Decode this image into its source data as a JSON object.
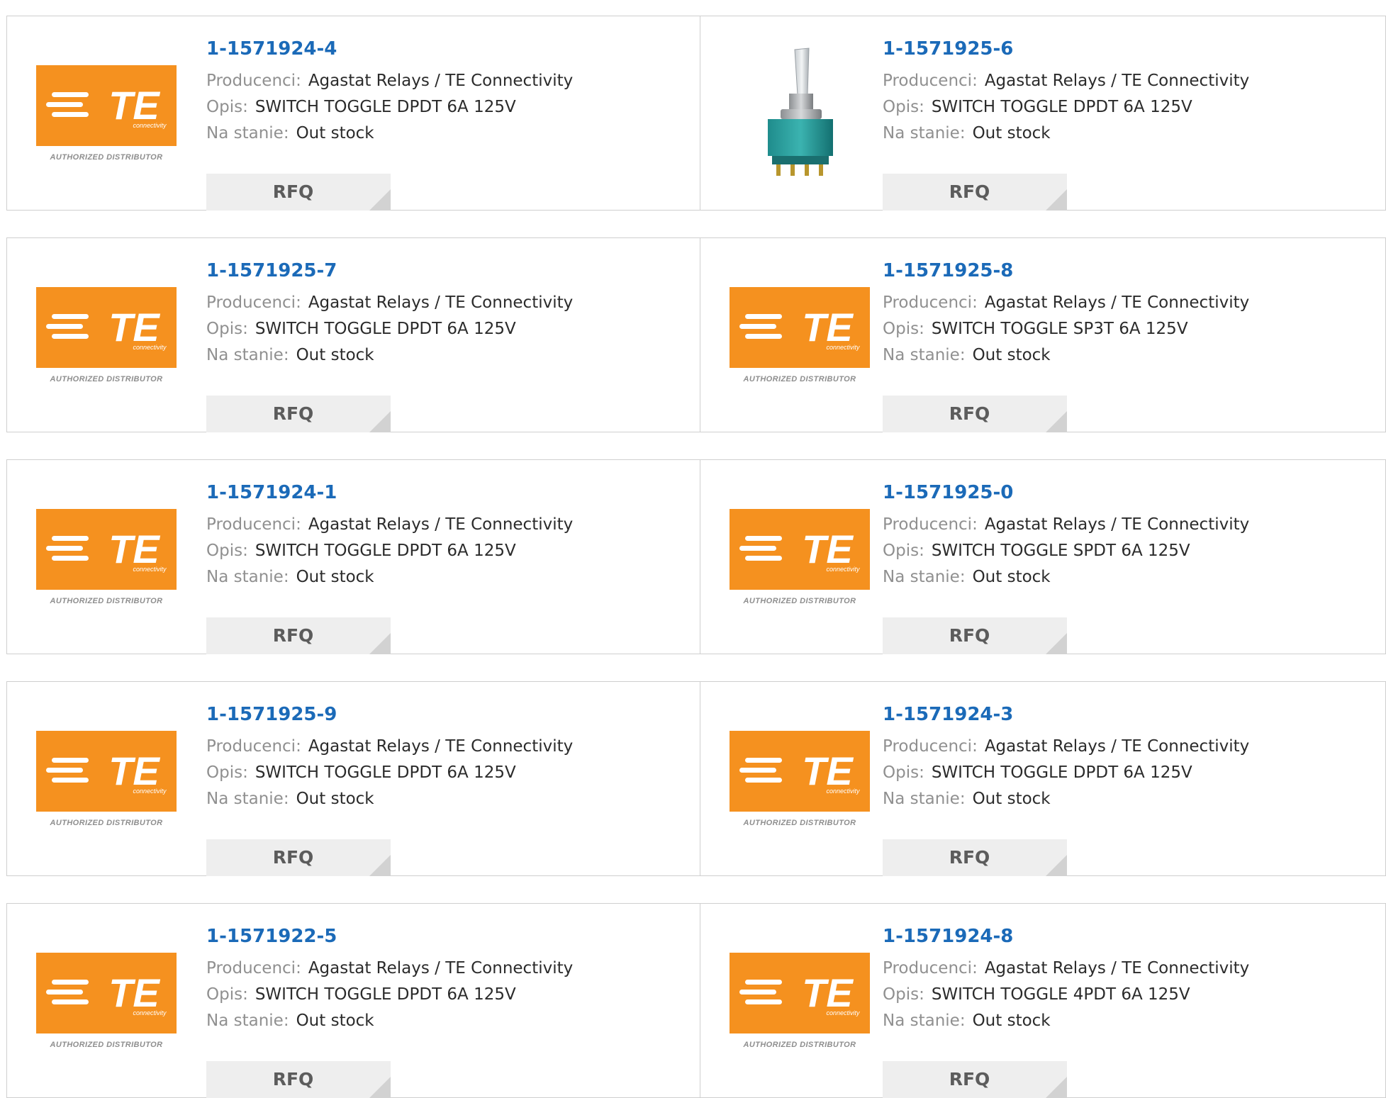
{
  "colors": {
    "part_number": "#1b6ab8",
    "te_orange": "#f5911f",
    "rfq_bg": "#eeeeee"
  },
  "labels": {
    "manufacturer": "Producenci:",
    "description": "Opis:",
    "stock": "Na stanie:",
    "rfq": "RFQ"
  },
  "brand": {
    "logo_text": "TE",
    "tagline": "connectivity",
    "badge": "AUTHORIZED DISTRIBUTOR"
  },
  "rows": [
    [
      {
        "part": "1-1571924-4",
        "manufacturer": "Agastat Relays / TE Connectivity",
        "description": "SWITCH TOGGLE DPDT 6A 125V",
        "stock": "Out stock",
        "image": "te-logo"
      },
      {
        "part": "1-1571925-6",
        "manufacturer": "Agastat Relays / TE Connectivity",
        "description": "SWITCH TOGGLE DPDT 6A 125V",
        "stock": "Out stock",
        "image": "toggle-switch-photo"
      }
    ],
    [
      {
        "part": "1-1571925-7",
        "manufacturer": "Agastat Relays / TE Connectivity",
        "description": "SWITCH TOGGLE DPDT 6A 125V",
        "stock": "Out stock",
        "image": "te-logo"
      },
      {
        "part": "1-1571925-8",
        "manufacturer": "Agastat Relays / TE Connectivity",
        "description": "SWITCH TOGGLE SP3T 6A 125V",
        "stock": "Out stock",
        "image": "te-logo"
      }
    ],
    [
      {
        "part": "1-1571924-1",
        "manufacturer": "Agastat Relays / TE Connectivity",
        "description": "SWITCH TOGGLE DPDT 6A 125V",
        "stock": "Out stock",
        "image": "te-logo"
      },
      {
        "part": "1-1571925-0",
        "manufacturer": "Agastat Relays / TE Connectivity",
        "description": "SWITCH TOGGLE SPDT 6A 125V",
        "stock": "Out stock",
        "image": "te-logo"
      }
    ],
    [
      {
        "part": "1-1571925-9",
        "manufacturer": "Agastat Relays / TE Connectivity",
        "description": "SWITCH TOGGLE DPDT 6A 125V",
        "stock": "Out stock",
        "image": "te-logo"
      },
      {
        "part": "1-1571924-3",
        "manufacturer": "Agastat Relays / TE Connectivity",
        "description": "SWITCH TOGGLE DPDT 6A 125V",
        "stock": "Out stock",
        "image": "te-logo"
      }
    ],
    [
      {
        "part": "1-1571922-5",
        "manufacturer": "Agastat Relays / TE Connectivity",
        "description": "SWITCH TOGGLE DPDT 6A 125V",
        "stock": "Out stock",
        "image": "te-logo"
      },
      {
        "part": "1-1571924-8",
        "manufacturer": "Agastat Relays / TE Connectivity",
        "description": "SWITCH TOGGLE 4PDT 6A 125V",
        "stock": "Out stock",
        "image": "te-logo"
      }
    ]
  ]
}
